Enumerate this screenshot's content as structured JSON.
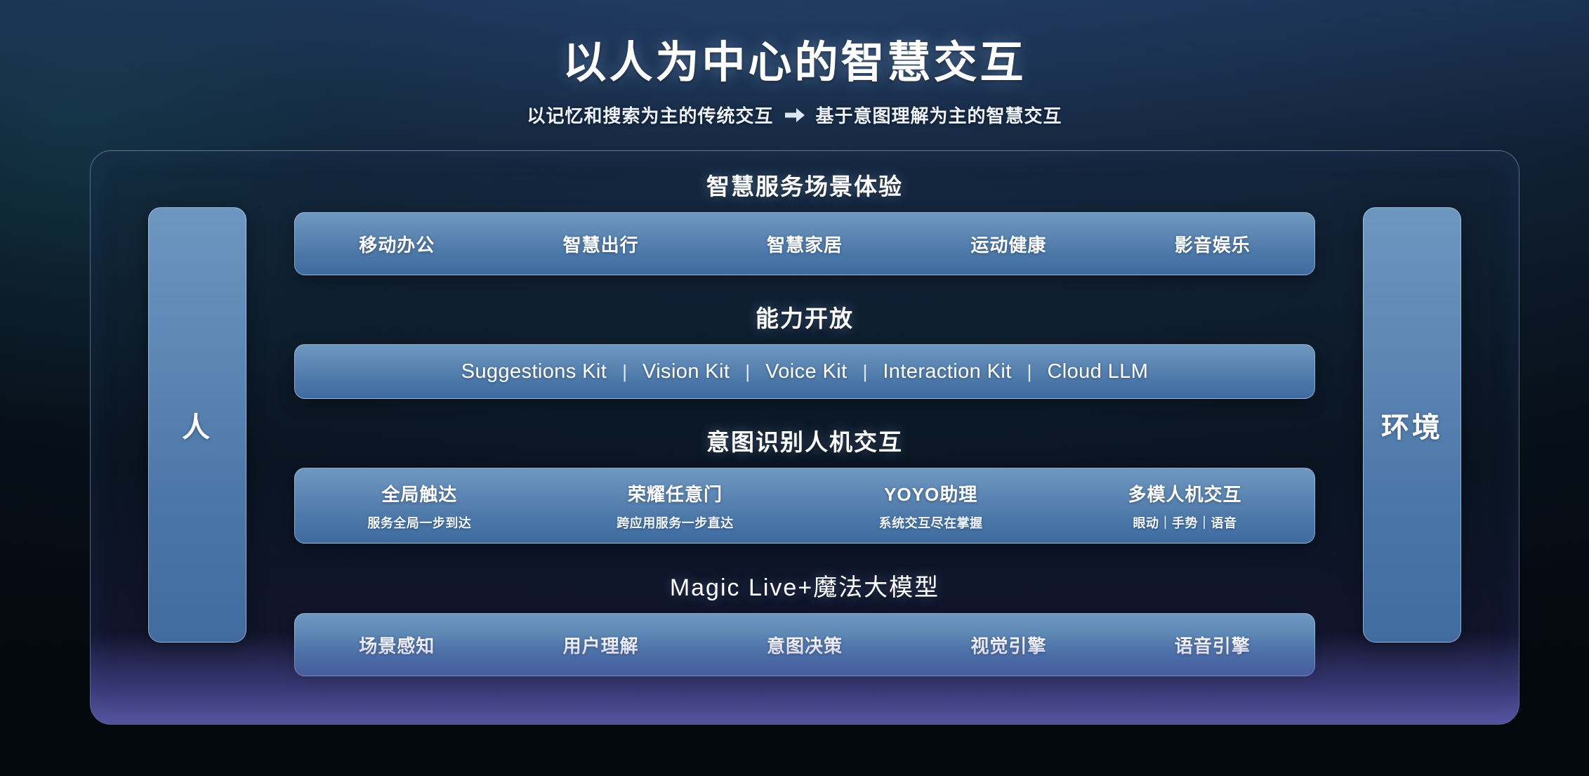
{
  "header": {
    "title": "以人为中心的智慧交互",
    "subtitle_before": "以记忆和搜索为主的传统交互",
    "arrow_icon": "arrow-right-icon",
    "subtitle_after": "基于意图理解为主的智慧交互"
  },
  "pillars": {
    "left_label": "人",
    "right_label": "环境"
  },
  "sections": [
    {
      "title": "智慧服务场景体验",
      "type": "simple",
      "items": [
        {
          "title": "移动办公"
        },
        {
          "title": "智慧出行"
        },
        {
          "title": "智慧家居"
        },
        {
          "title": "运动健康"
        },
        {
          "title": "影音娱乐"
        }
      ]
    },
    {
      "title": "能力开放",
      "type": "kits",
      "separator": "|",
      "items": [
        {
          "title": "Suggestions Kit"
        },
        {
          "title": "Vision Kit"
        },
        {
          "title": "Voice Kit"
        },
        {
          "title": "Interaction Kit"
        },
        {
          "title": "Cloud LLM"
        }
      ]
    },
    {
      "title": "意图识别人机交互",
      "type": "duo",
      "items": [
        {
          "title": "全局触达",
          "sub": "服务全局一步到达"
        },
        {
          "title": "荣耀任意门",
          "sub": "跨应用服务一步直达"
        },
        {
          "title": "YOYO助理",
          "sub": "系统交互尽在掌握"
        },
        {
          "title": "多模人机交互",
          "sub": "眼动｜手势｜语音"
        }
      ]
    },
    {
      "title": "Magic Live+魔法大模型",
      "type": "simple",
      "items": [
        {
          "title": "场景感知"
        },
        {
          "title": "用户理解"
        },
        {
          "title": "意图决策"
        },
        {
          "title": "视觉引擎"
        },
        {
          "title": "语音引擎"
        }
      ]
    }
  ],
  "colors": {
    "pill_top": "#6f98c0",
    "pill_bottom": "#3f6a9e",
    "text": "#ffffff",
    "frame_border": "rgba(180,205,235,.42)",
    "bg_deep": "#060d14",
    "bottom_glow": "#605eb4"
  }
}
